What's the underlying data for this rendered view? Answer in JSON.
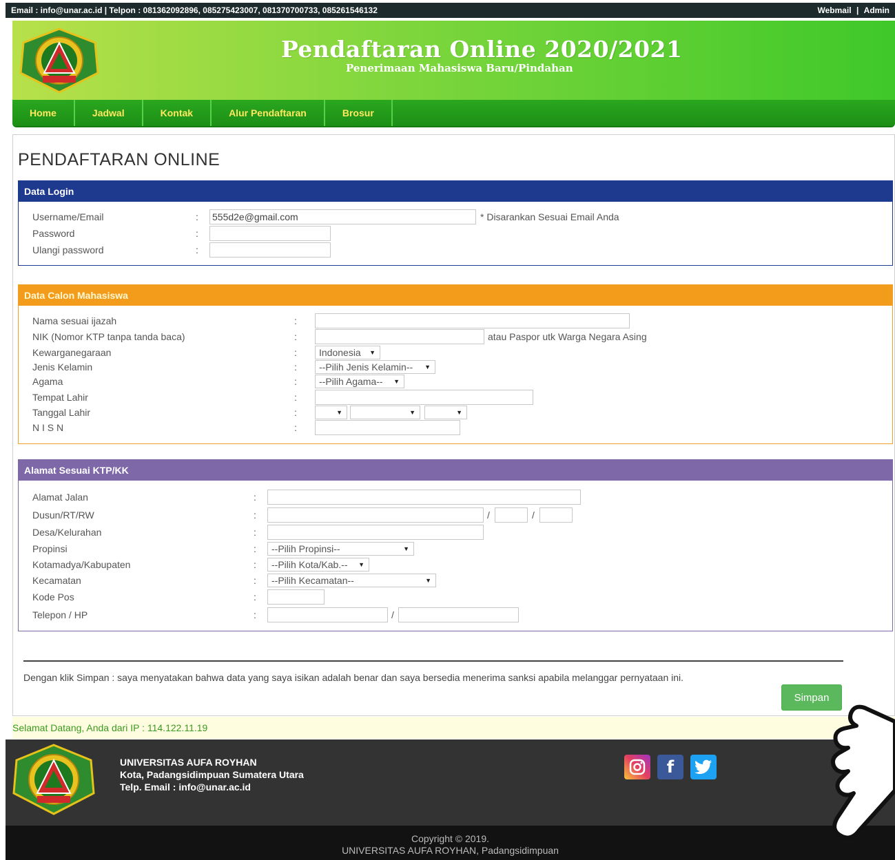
{
  "topbar": {
    "contact": "Email : info@unar.ac.id  |  Telpon : 081362092896, 085275423007, 081370700733, 085261546132",
    "webmail": "Webmail",
    "separator": "|",
    "admin": "Admin"
  },
  "header": {
    "title": "Pendaftaran Online 2020/2021",
    "subtitle": "Penerimaan Mahasiswa Baru/Pindahan",
    "logo_icon": "university-seal"
  },
  "nav": {
    "items": [
      {
        "label": "Home"
      },
      {
        "label": "Jadwal"
      },
      {
        "label": "Kontak"
      },
      {
        "label": "Alur Pendaftaran"
      },
      {
        "label": "Brosur"
      }
    ]
  },
  "main": {
    "page_title": "PENDAFTARAN ONLINE",
    "login": {
      "heading": "Data Login",
      "username_label": "Username/Email",
      "username_value": "555d2e@gmail.com",
      "username_note": "* Disarankan Sesuai Email Anda",
      "password_label": "Password",
      "password_value": "",
      "repeat_label": "Ulangi password",
      "repeat_value": ""
    },
    "candidate": {
      "heading": "Data Calon Mahasiswa",
      "name_label": "Nama sesuai ijazah",
      "nik_label": "NIK (Nomor KTP tanpa tanda baca)",
      "nik_note": "atau Paspor utk Warga Negara Asing",
      "citizenship_label": "Kewarganegaraan",
      "citizenship_value": "Indonesia",
      "gender_label": "Jenis Kelamin",
      "gender_value": "--Pilih Jenis Kelamin--",
      "religion_label": "Agama",
      "religion_value": "--Pilih Agama--",
      "birthplace_label": "Tempat Lahir",
      "birthdate_label": "Tanggal Lahir",
      "nisn_label": "N I S N"
    },
    "address": {
      "heading": "Alamat Sesuai KTP/KK",
      "street_label": "Alamat Jalan",
      "dusun_label": "Dusun/RT/RW",
      "desa_label": "Desa/Kelurahan",
      "province_label": "Propinsi",
      "province_value": "--Pilih Propinsi--",
      "city_label": "Kotamadya/Kabupaten",
      "city_value": "--Pilih Kota/Kab.--",
      "district_label": "Kecamatan",
      "district_value": "--Pilih Kecamatan--",
      "postal_label": "Kode Pos",
      "phone_label": "Telepon / HP"
    },
    "colon": ":",
    "slash": "/",
    "agreement": "Dengan klik Simpan : saya menyatakan bahwa data yang saya isikan adalah benar dan saya bersedia menerima sanksi apabila melanggar pernyataan ini.",
    "save_label": "Simpan"
  },
  "welcome": "Selamat Datang, Anda dari IP : 114.122.11.19",
  "footer": {
    "university": "UNIVERSITAS AUFA ROYHAN",
    "address": "Kota, Padangsidimpuan Sumatera Utara",
    "contact": "Telp. Email : info@unar.ac.id",
    "social": [
      "instagram-icon",
      "facebook-icon",
      "twitter-icon"
    ],
    "copyright": "Copyright © 2019.",
    "copyright_org": "UNIVERSITAS AUFA ROYHAN, Padangsidimpuan"
  },
  "colors": {
    "login_header": "#1e3a8e",
    "candidate_header": "#f39c1c",
    "address_header": "#7e68a8",
    "save_button": "#5cb85c",
    "nav": "#2aa71f"
  }
}
